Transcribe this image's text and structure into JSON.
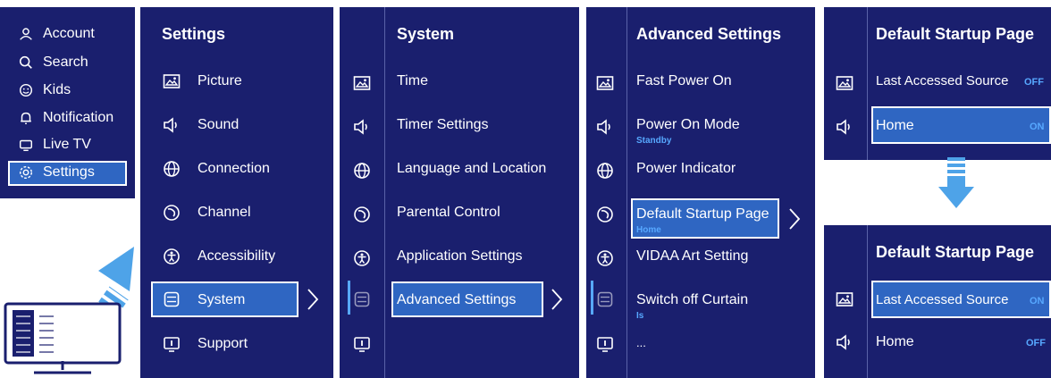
{
  "colors": {
    "panel": "#1a1f6e",
    "highlight": "#2f66c2",
    "accent": "#57a8ff",
    "arrow": "#4ea3e8"
  },
  "home_menu": {
    "items": [
      {
        "icon": "person-icon",
        "label": "Account"
      },
      {
        "icon": "search-icon",
        "label": "Search"
      },
      {
        "icon": "kids-icon",
        "label": "Kids"
      },
      {
        "icon": "bell-icon",
        "label": "Notification"
      },
      {
        "icon": "tv-icon",
        "label": "Live TV"
      },
      {
        "icon": "gear-icon",
        "label": "Settings"
      }
    ]
  },
  "settings": {
    "title": "Settings",
    "items": [
      {
        "icon": "picture-icon",
        "label": "Picture"
      },
      {
        "icon": "sound-icon",
        "label": "Sound"
      },
      {
        "icon": "globe-icon",
        "label": "Connection"
      },
      {
        "icon": "channel-icon",
        "label": "Channel"
      },
      {
        "icon": "accessibility-icon",
        "label": "Accessibility"
      },
      {
        "icon": "system-icon",
        "label": "System"
      },
      {
        "icon": "support-icon",
        "label": "Support"
      }
    ]
  },
  "system": {
    "title": "System",
    "items": [
      {
        "label": "Time"
      },
      {
        "label": "Timer Settings"
      },
      {
        "label": "Language and Location"
      },
      {
        "label": "Parental Control"
      },
      {
        "label": "Application Settings"
      },
      {
        "label": "Advanced Settings"
      }
    ]
  },
  "advanced": {
    "title": "Advanced Settings",
    "items": [
      {
        "label": "Fast Power On"
      },
      {
        "label": "Power On Mode",
        "sub": "Standby"
      },
      {
        "label": "Power Indicator"
      },
      {
        "label": "Default Startup Page",
        "sub": "Home"
      },
      {
        "label": "VIDAA Art Setting"
      },
      {
        "label": "Switch off Curtain",
        "sub": "Is"
      },
      {
        "label": "..."
      }
    ]
  },
  "startup_top": {
    "title": "Default Startup Page",
    "items": [
      {
        "label": "Last Accessed Source",
        "state": "OFF"
      },
      {
        "label": "Home",
        "state": "ON"
      }
    ]
  },
  "startup_bottom": {
    "title": "Default Startup Page",
    "items": [
      {
        "label": "Last Accessed Source",
        "state": "ON"
      },
      {
        "label": "Home",
        "state": "OFF"
      }
    ]
  }
}
